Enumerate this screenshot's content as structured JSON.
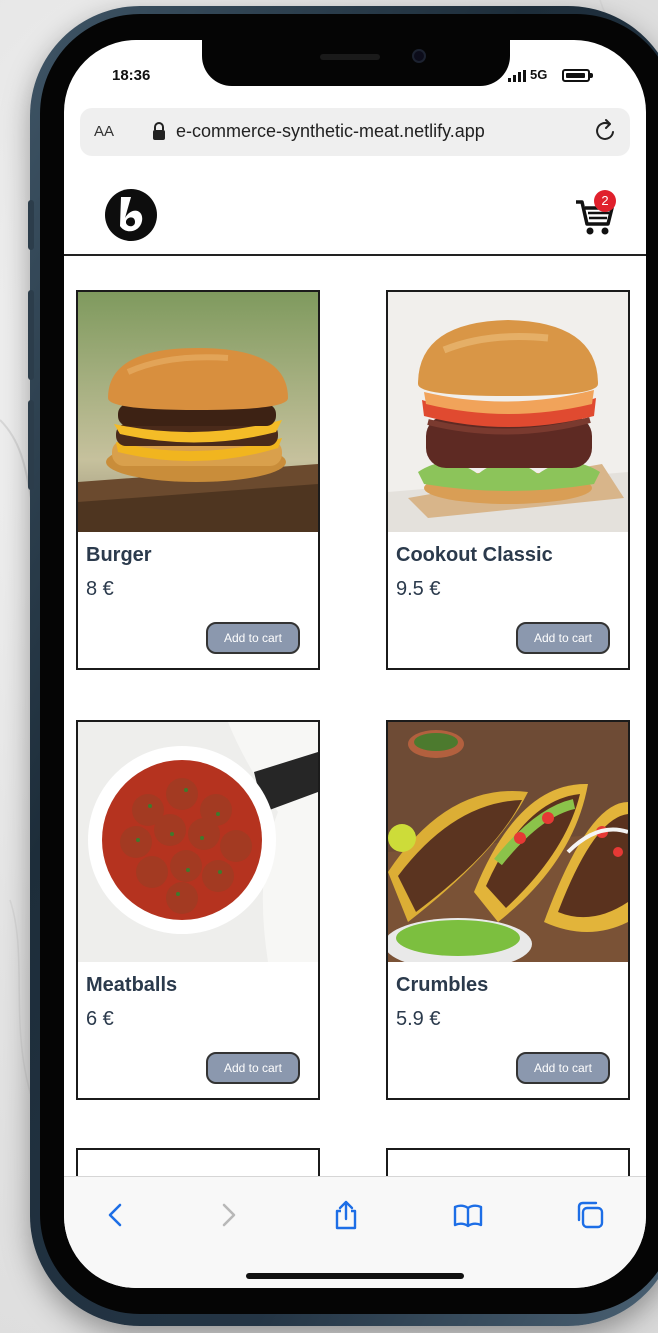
{
  "status_bar": {
    "time": "18:36",
    "network": "5G"
  },
  "browser": {
    "text_size_label": "AA",
    "url": "e-commerce-synthetic-meat.netlify.app",
    "accent_color": "#1d6ee6"
  },
  "header": {
    "cart_count": "2",
    "badge_color": "#e0202c"
  },
  "products": [
    {
      "name": "Burger",
      "price": "8 €",
      "button": "Add to cart"
    },
    {
      "name": "Cookout Classic",
      "price": "9.5 €",
      "button": "Add to cart"
    },
    {
      "name": "Meatballs",
      "price": "6 €",
      "button": "Add to cart"
    },
    {
      "name": "Crumbles",
      "price": "5.9 €",
      "button": "Add to cart"
    }
  ],
  "bottom_nav": {
    "icons": [
      "back-icon",
      "forward-icon",
      "share-icon",
      "bookmarks-icon",
      "tabs-icon"
    ]
  }
}
